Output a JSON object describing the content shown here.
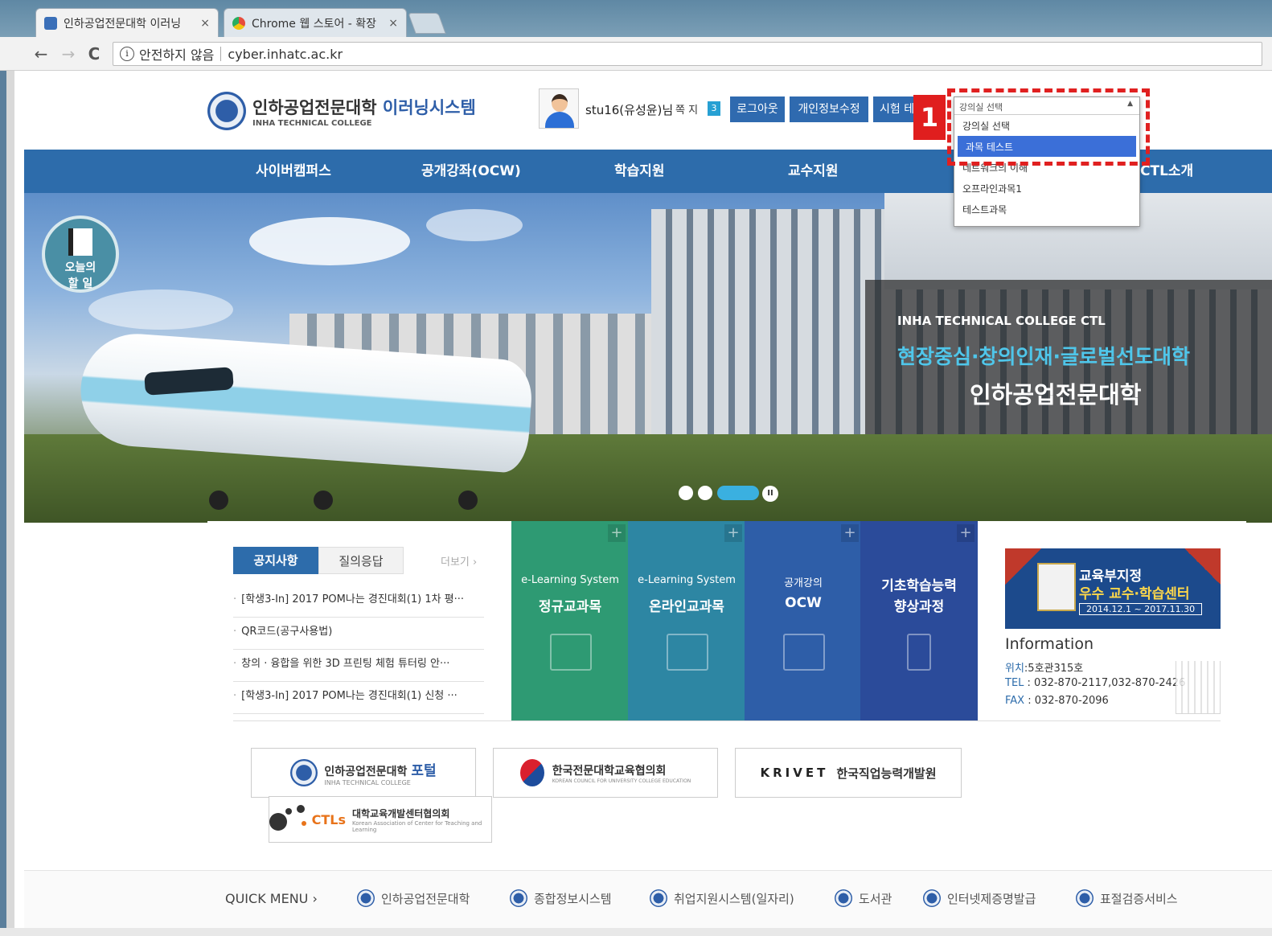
{
  "browser": {
    "tabs": [
      {
        "title": "인하공업전문대학 이러닝",
        "close": "×"
      },
      {
        "title": "Chrome 웹 스토어 - 확장",
        "close": "×"
      }
    ],
    "nav": {
      "back": "←",
      "forward": "→",
      "reload": "C"
    },
    "address": {
      "info": "i",
      "security": "안전하지 않음",
      "url": "cyber.inhatc.ac.kr"
    }
  },
  "header": {
    "logo_name": "인하공업전문대학",
    "logo_accent": "이러닝시스템",
    "logo_sub": "INHA TECHNICAL COLLEGE",
    "user": "stu16(유성윤)님",
    "message_label": "쪽 지",
    "message_count": "3",
    "buttons": [
      "로그아웃",
      "개인정보수정",
      "시험 테"
    ]
  },
  "course_select": {
    "label": "강의실 선택",
    "options": [
      "강의실 선택",
      "과목 테스트",
      "네트워크의 이해",
      "오프라인과목1",
      "테스트과목"
    ],
    "selected": "과목 테스트",
    "marker": "1"
  },
  "gnb": [
    "사이버캠퍼스",
    "공개강좌(OCW)",
    "학습지원",
    "교수지원",
    "CTL소개"
  ],
  "hero": {
    "line1": "INHA TECHNICAL COLLEGE CTL",
    "line2": "현장중심·창의인재·글로벌선도대학",
    "line3": "인하공업전문대학",
    "todo": [
      "오늘의",
      "할 일"
    ],
    "pause": "II"
  },
  "notice": {
    "tabs": [
      "공지사항",
      "질의응답"
    ],
    "more": "더보기 ›",
    "items": [
      "[학생3-In] 2017 POM나는 경진대회(1) 1차 평···",
      "QR코드(공구사용법)",
      "창의 · 융합을 위한 3D 프린팅 체험 튜터링 안···",
      "[학생3-In] 2017 POM나는 경진대회(1) 신청 ···"
    ]
  },
  "tiles": [
    {
      "sub": "e-Learning System",
      "main": "정규교과목",
      "color": "#2e9a73",
      "icon": "book-icon"
    },
    {
      "sub": "e-Learning System",
      "main": "온라인교과목",
      "color": "#2d86a3",
      "icon": "monitor-icon"
    },
    {
      "sub": "공개강의",
      "main": "OCW",
      "color": "#2e5ea8",
      "icon": "video-icon"
    },
    {
      "sub": "기초학습능력",
      "main": "향상과정",
      "color": "#2b4b9a",
      "icon": "pencil-icon"
    }
  ],
  "info": {
    "award1": "교육부지정",
    "award2": "우수 교수·학습센터",
    "award3": "2014.12.1 ~ 2017.11.30",
    "title": "Information",
    "location_label": "위치",
    "location": ":5호관315호",
    "tel_label": "TEL",
    "tel": " : 032-870-2117,032-870-2426",
    "fax_label": "FAX",
    "fax": " : 032-870-2096"
  },
  "partners": {
    "portal_name": "인하공업전문대학",
    "portal_sub": "INHA TECHNICAL COLLEGE",
    "portal_accent": "포털",
    "kcce": "한국전문대학교육협의회",
    "kcce_sub": "KOREAN COUNCIL FOR UNIVERSITY COLLEGE EDUCATION",
    "krivet_logo": "KRIVET",
    "krivet": "한국직업능력개발원",
    "ctls_logo": "CTLs",
    "ctls": "대학교육개발센터협의회",
    "ctls_sub": "Korean Association of Center for Teaching and Learning"
  },
  "quick_menu": {
    "title": "QUICK MENU ›",
    "items": [
      "인하공업전문대학",
      "종합정보시스템",
      "취업지원시스템(일자리)",
      "도서관",
      "인터넷제증명발급",
      "표절검증서비스"
    ]
  },
  "colors": {
    "nav_blue": "#2d6cab",
    "highlight_red": "#e02020",
    "accent_cyan": "#4fc6ea"
  }
}
